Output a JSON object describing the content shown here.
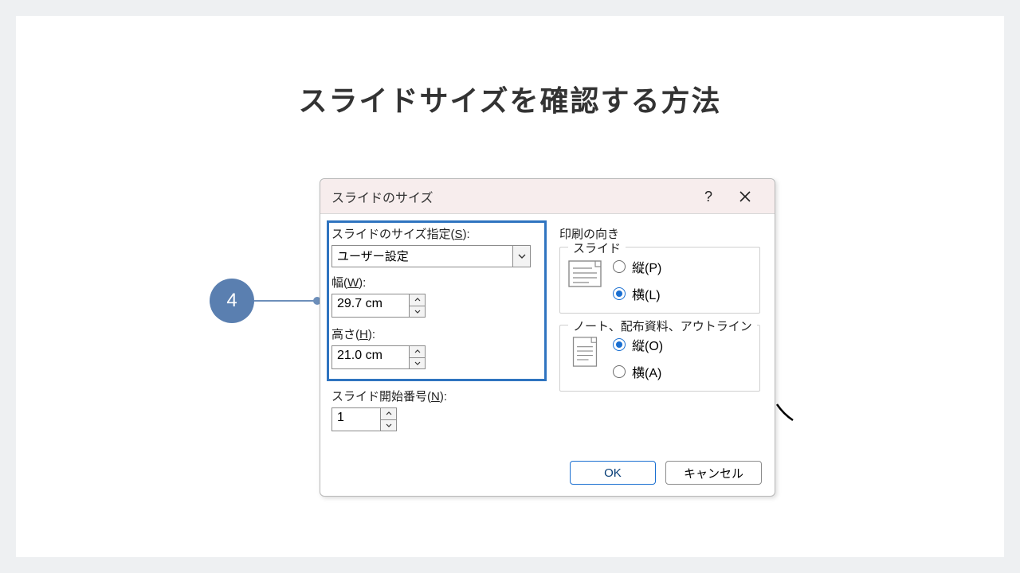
{
  "page_title": "スライドサイズを確認する方法",
  "step_number": "4",
  "dialog": {
    "title": "スライドのサイズ",
    "labels": {
      "size_spec": "スライドのサイズ指定(",
      "size_spec_key": "S",
      "size_spec_after": "):",
      "width": "幅(",
      "width_key": "W",
      "width_after": "):",
      "height": "高さ(",
      "height_key": "H",
      "height_after": "):",
      "start_no": "スライド開始番号(",
      "start_no_key": "N",
      "start_no_after": "):"
    },
    "size_value": "ユーザー設定",
    "width_value": "29.7 cm",
    "height_value": "21.0 cm",
    "start_no_value": "1",
    "orientation_title": "印刷の向き",
    "slides_legend": "スライド",
    "notes_legend": "ノート、配布資料、アウトライン",
    "radio": {
      "portrait_p": "縦(",
      "portrait_p_key": "P",
      "portrait_p_after": ")",
      "landscape_l": "横(",
      "landscape_l_key": "L",
      "landscape_l_after": ")",
      "portrait_o": "縦(",
      "portrait_o_key": "O",
      "portrait_o_after": ")",
      "landscape_a": "横(",
      "landscape_a_key": "A",
      "landscape_a_after": ")"
    },
    "buttons": {
      "ok": "OK",
      "cancel": "キャンセル"
    }
  }
}
